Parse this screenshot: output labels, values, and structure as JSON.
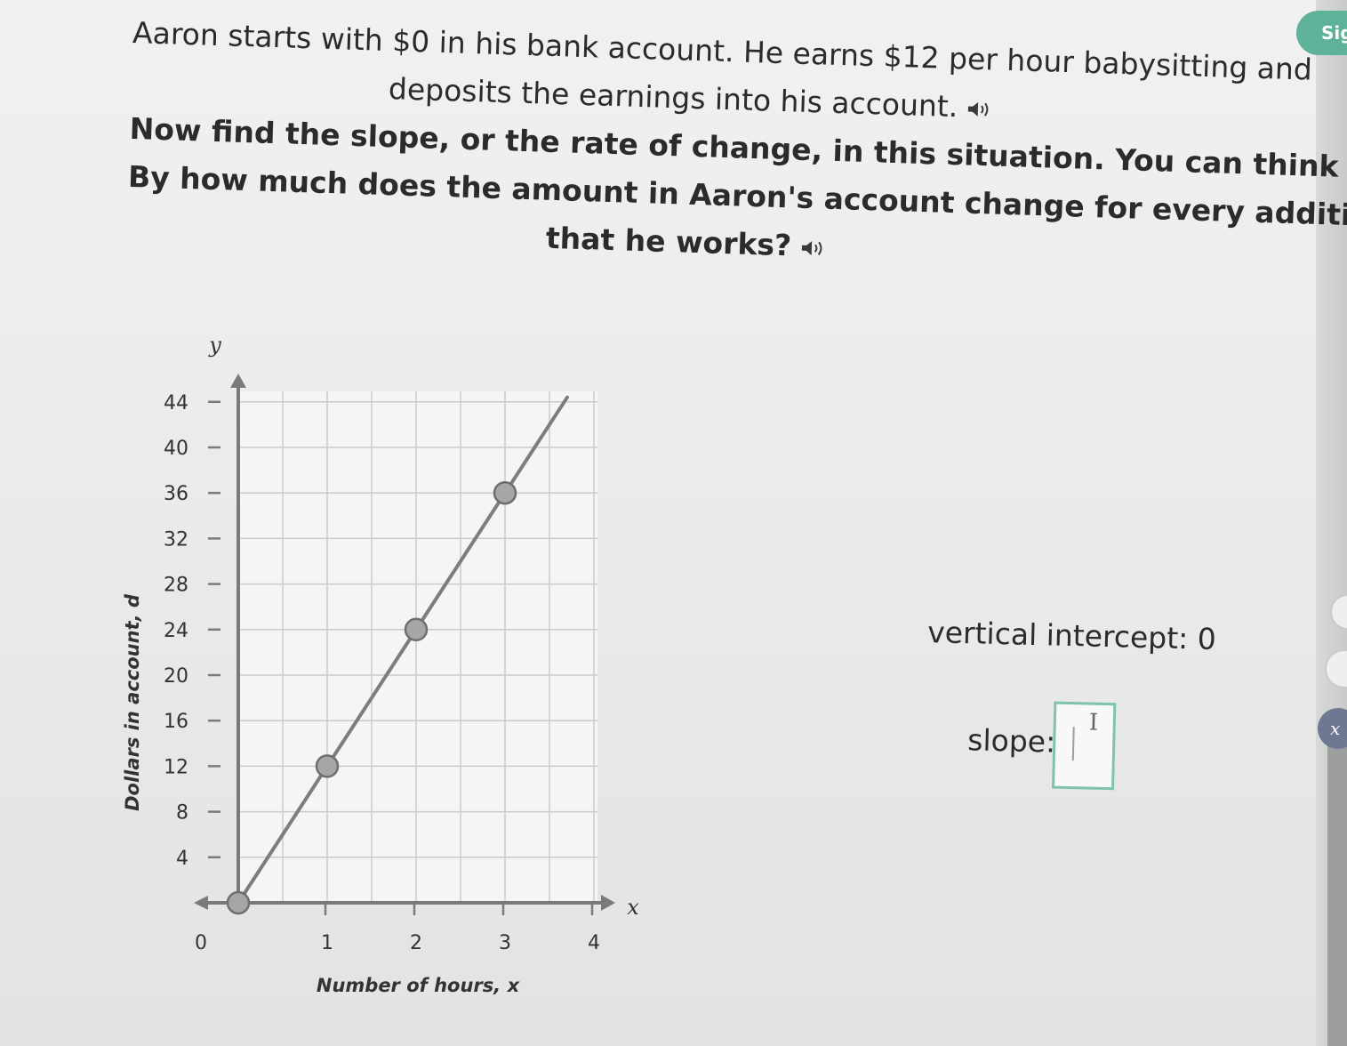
{
  "header": {
    "sign_label": "Sig"
  },
  "problem": {
    "line1": "Aaron starts with $0 in his bank account. He earns $12 per hour babysitting and",
    "line2": "deposits the earnings into his account.",
    "question_line1": "Now find the slope, or the rate of change, in this situation. You can think of this as:",
    "question_line2": "By how much does the amount in Aaron's account change for every additional hour",
    "question_line3": "that he works?"
  },
  "icons": {
    "speaker": "speaker-icon",
    "text_cursor": "text-cursor-icon"
  },
  "sidebar": {
    "variable_button_label": "x"
  },
  "answers": {
    "intercept_label": "vertical intercept: 0",
    "slope_label": "slope:",
    "slope_value": ""
  },
  "colors": {
    "accent": "#7fc3a9",
    "sign_button": "#5fb29a",
    "line": "#7d7d7d",
    "point_fill": "#a6a6a6"
  },
  "chart_data": {
    "type": "line",
    "xlabel": "Number of hours, x",
    "ylabel": "Dollars in account, d",
    "x_axis_symbol": "x",
    "y_axis_symbol": "y",
    "xlim": [
      0,
      4.2
    ],
    "ylim": [
      0,
      44
    ],
    "x_ticks": [
      0,
      1,
      2,
      3,
      4
    ],
    "y_ticks": [
      4,
      8,
      12,
      16,
      20,
      24,
      28,
      32,
      36,
      40,
      44
    ],
    "grid": true,
    "line": {
      "x": [
        0,
        3.7
      ],
      "y": [
        0,
        44.4
      ]
    },
    "points": {
      "x": [
        0,
        1,
        2,
        3
      ],
      "y": [
        0,
        12,
        24,
        36
      ]
    }
  }
}
